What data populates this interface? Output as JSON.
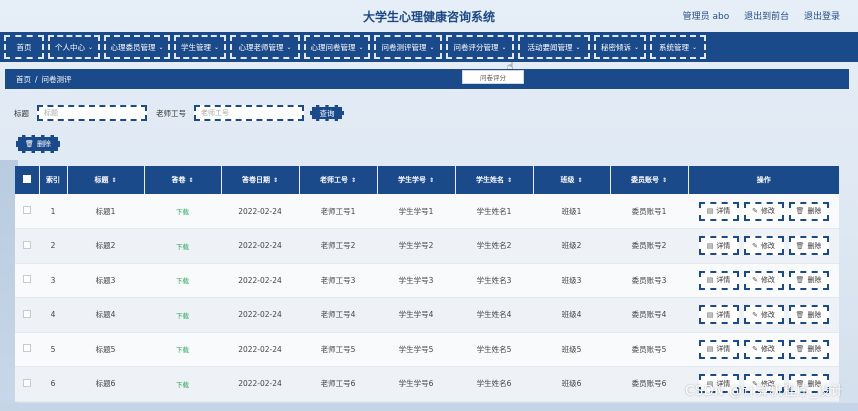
{
  "header": {
    "title": "大学生心理健康咨询系统",
    "admin": "管理员 abo",
    "back_to_front": "退出到前台",
    "logout": "退出登录"
  },
  "nav": {
    "items": [
      {
        "label": "首页",
        "dropdown": false
      },
      {
        "label": "个人中心",
        "dropdown": true
      },
      {
        "label": "心理委员管理",
        "dropdown": true
      },
      {
        "label": "学生管理",
        "dropdown": true
      },
      {
        "label": "心理老师管理",
        "dropdown": true
      },
      {
        "label": "心理问卷管理",
        "dropdown": true
      },
      {
        "label": "问卷测评管理",
        "dropdown": true
      },
      {
        "label": "问卷评分管理",
        "dropdown": true
      },
      {
        "label": "活动要闻管理",
        "dropdown": true
      },
      {
        "label": "秘密倾诉",
        "dropdown": true
      },
      {
        "label": "系统管理",
        "dropdown": true
      }
    ],
    "open_dropdown_item": "问卷评分"
  },
  "breadcrumb": {
    "home": "首页",
    "separator": "/",
    "current": "问卷测评"
  },
  "filters": {
    "title_label": "标题",
    "title_placeholder": "标题",
    "teacher_label": "老师工号",
    "teacher_placeholder": "老师工号",
    "search_button": "查询"
  },
  "actions": {
    "delete_button": "删除"
  },
  "table": {
    "headers": [
      "索引",
      "标题",
      "答卷",
      "答卷日期",
      "老师工号",
      "学生学号",
      "学生姓名",
      "班级",
      "委员账号",
      "操作"
    ],
    "rows": [
      {
        "index": "1",
        "title": "标题1",
        "answer": "下载",
        "date": "2022-02-24",
        "teacher": "老师工号1",
        "student_id": "学生学号1",
        "student_name": "学生姓名1",
        "class": "班级1",
        "committee": "委员账号1"
      },
      {
        "index": "2",
        "title": "标题2",
        "answer": "下载",
        "date": "2022-02-24",
        "teacher": "老师工号2",
        "student_id": "学生学号2",
        "student_name": "学生姓名2",
        "class": "班级2",
        "committee": "委员账号2"
      },
      {
        "index": "3",
        "title": "标题3",
        "answer": "下载",
        "date": "2022-02-24",
        "teacher": "老师工号3",
        "student_id": "学生学号3",
        "student_name": "学生姓名3",
        "class": "班级3",
        "committee": "委员账号3"
      },
      {
        "index": "4",
        "title": "标题4",
        "answer": "下载",
        "date": "2022-02-24",
        "teacher": "老师工号4",
        "student_id": "学生学号4",
        "student_name": "学生姓名4",
        "class": "班级4",
        "committee": "委员账号4"
      },
      {
        "index": "5",
        "title": "标题5",
        "answer": "下载",
        "date": "2022-02-24",
        "teacher": "老师工号5",
        "student_id": "学生学号5",
        "student_name": "学生姓名5",
        "class": "班级5",
        "committee": "委员账号5"
      },
      {
        "index": "6",
        "title": "标题6",
        "answer": "下载",
        "date": "2022-02-24",
        "teacher": "老师工号6",
        "student_id": "学生学号6",
        "student_name": "学生姓名6",
        "class": "班级6",
        "committee": "委员账号6"
      }
    ],
    "row_actions": {
      "detail": "详情",
      "edit": "修改",
      "delete": "删除"
    }
  },
  "watermark": "CSDN @计算机程序_设计",
  "colors": {
    "primary": "#1b4a8a",
    "download": "#2fa55b",
    "title": "#1d4a86"
  },
  "icons": {
    "sort": "sort-icon",
    "delete": "trash-icon",
    "detail": "document-icon",
    "edit": "pencil-icon",
    "chevron": "chevron-down-icon"
  }
}
